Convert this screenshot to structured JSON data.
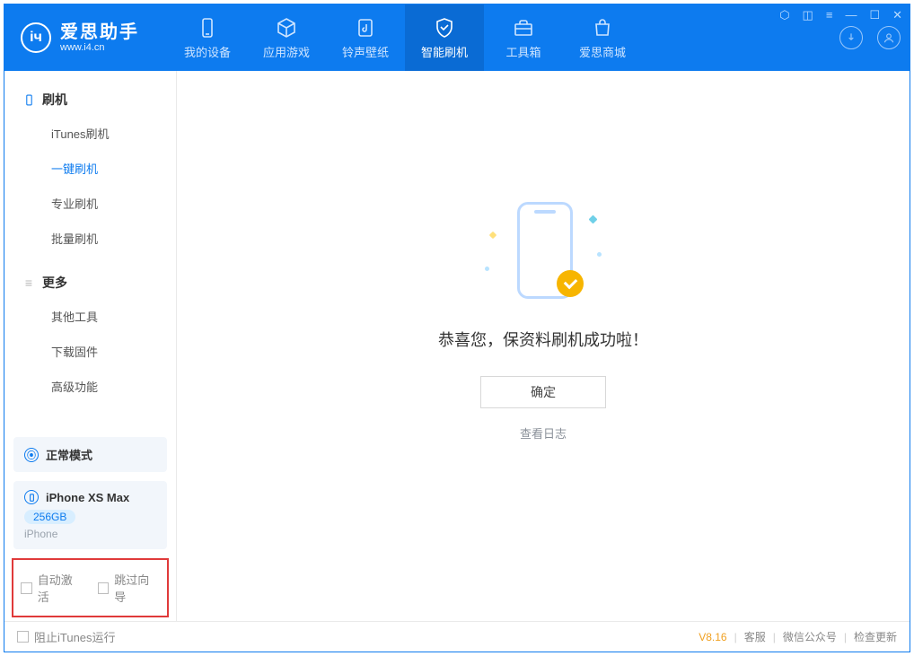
{
  "app": {
    "name": "爱思助手",
    "url": "www.i4.cn"
  },
  "nav": {
    "items": [
      {
        "id": "device",
        "label": "我的设备"
      },
      {
        "id": "apps",
        "label": "应用游戏"
      },
      {
        "id": "ring",
        "label": "铃声壁纸"
      },
      {
        "id": "flash",
        "label": "智能刷机",
        "active": true
      },
      {
        "id": "tools",
        "label": "工具箱"
      },
      {
        "id": "store",
        "label": "爱思商城"
      }
    ]
  },
  "sidebar": {
    "group1": {
      "title": "刷机",
      "items": [
        {
          "label": "iTunes刷机"
        },
        {
          "label": "一键刷机",
          "active": true
        },
        {
          "label": "专业刷机"
        },
        {
          "label": "批量刷机"
        }
      ]
    },
    "group2": {
      "title": "更多",
      "items": [
        {
          "label": "其他工具"
        },
        {
          "label": "下载固件"
        },
        {
          "label": "高级功能"
        }
      ]
    },
    "mode_panel": {
      "label": "正常模式"
    },
    "device_panel": {
      "name": "iPhone XS Max",
      "storage": "256GB",
      "type": "iPhone"
    },
    "options": {
      "auto_activate": "自动激活",
      "skip_guide": "跳过向导"
    }
  },
  "main": {
    "success_msg": "恭喜您，保资料刷机成功啦！",
    "ok_button": "确定",
    "view_log": "查看日志"
  },
  "footer": {
    "block_itunes": "阻止iTunes运行",
    "version": "V8.16",
    "links": {
      "support": "客服",
      "wechat": "微信公众号",
      "update": "检查更新"
    }
  }
}
